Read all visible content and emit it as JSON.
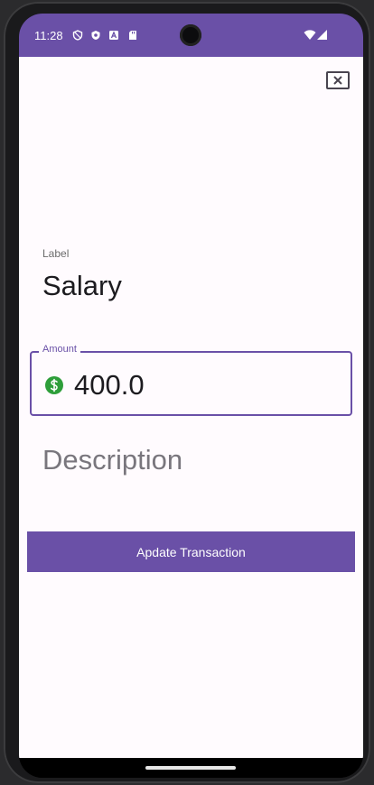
{
  "status_bar": {
    "time": "11:28",
    "icons": [
      "shield-outline-icon",
      "shield-icon",
      "a-icon",
      "sd-card-icon",
      "camera-icon",
      "wifi-icon",
      "signal-icon"
    ],
    "color": "#6a50a7"
  },
  "form": {
    "close_icon": "close-icon",
    "label_caption": "Label",
    "label_value": "Salary",
    "amount_caption": "Amount",
    "amount_value": "400.0",
    "amount_icon": "dollar-circle-icon",
    "description_placeholder": "Description",
    "submit_label": "Apdate Transaction"
  },
  "colors": {
    "accent": "#6a50a7",
    "dollar": "#2e9e3a",
    "background": "#fffbfe"
  }
}
